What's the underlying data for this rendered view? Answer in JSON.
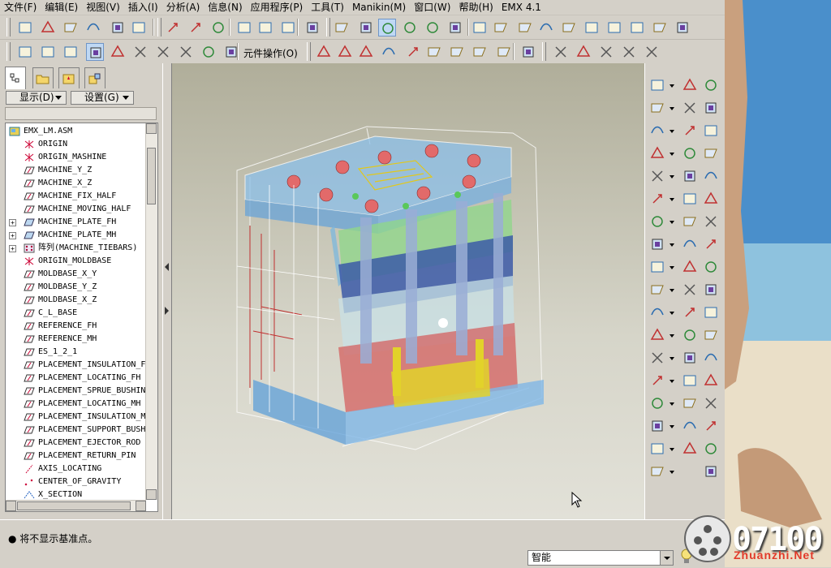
{
  "menu": {
    "items": [
      "文件(F)",
      "编辑(E)",
      "视图(V)",
      "插入(I)",
      "分析(A)",
      "信息(N)",
      "应用程序(P)",
      "工具(T)",
      "Manikin(M)",
      "窗口(W)",
      "帮助(H)",
      "EMX 4.1"
    ]
  },
  "toolbar2": {
    "component_op_label": "元件操作(O)"
  },
  "leftpanel": {
    "show_dropdown": "显示(D)",
    "settings_dropdown": "设置(G)",
    "tree": [
      {
        "label": "EMX_LM.ASM",
        "icon": "assembly-icon",
        "expand": ""
      },
      {
        "label": "ORIGIN",
        "icon": "csys-icon",
        "expand": ""
      },
      {
        "label": "ORIGIN_MASHINE",
        "icon": "csys-icon",
        "expand": ""
      },
      {
        "label": "MACHINE_Y_Z",
        "icon": "datum-plane-icon",
        "expand": ""
      },
      {
        "label": "MACHINE_X_Z",
        "icon": "datum-plane-icon",
        "expand": ""
      },
      {
        "label": "MACHINE_FIX_HALF",
        "icon": "datum-plane-icon",
        "expand": ""
      },
      {
        "label": "MACHINE_MOVING_HALF",
        "icon": "datum-plane-icon",
        "expand": ""
      },
      {
        "label": "MACHINE_PLATE_FH",
        "icon": "part-icon",
        "expand": "+"
      },
      {
        "label": "MACHINE_PLATE_MH",
        "icon": "part-icon",
        "expand": "+"
      },
      {
        "label": "阵列(MACHINE_TIEBARS)",
        "icon": "pattern-icon",
        "expand": "+"
      },
      {
        "label": "ORIGIN_MOLDBASE",
        "icon": "csys-icon",
        "expand": ""
      },
      {
        "label": "MOLDBASE_X_Y",
        "icon": "datum-plane-icon",
        "expand": ""
      },
      {
        "label": "MOLDBASE_Y_Z",
        "icon": "datum-plane-icon",
        "expand": ""
      },
      {
        "label": "MOLDBASE_X_Z",
        "icon": "datum-plane-icon",
        "expand": ""
      },
      {
        "label": "C_L_BASE",
        "icon": "datum-plane-icon",
        "expand": ""
      },
      {
        "label": "REFERENCE_FH",
        "icon": "datum-plane-icon",
        "expand": ""
      },
      {
        "label": "REFERENCE_MH",
        "icon": "datum-plane-icon",
        "expand": ""
      },
      {
        "label": "ES_1_2_1",
        "icon": "datum-plane-icon",
        "expand": ""
      },
      {
        "label": "PLACEMENT_INSULATION_F",
        "icon": "datum-plane-icon",
        "expand": ""
      },
      {
        "label": "PLACEMENT_LOCATING_FH",
        "icon": "datum-plane-icon",
        "expand": ""
      },
      {
        "label": "PLACEMENT_SPRUE_BUSHIN",
        "icon": "datum-plane-icon",
        "expand": ""
      },
      {
        "label": "PLACEMENT_LOCATING_MH",
        "icon": "datum-plane-icon",
        "expand": ""
      },
      {
        "label": "PLACEMENT_INSULATION_M",
        "icon": "datum-plane-icon",
        "expand": ""
      },
      {
        "label": "PLACEMENT_SUPPORT_BUSH",
        "icon": "datum-plane-icon",
        "expand": ""
      },
      {
        "label": "PLACEMENT_EJECTOR_ROD",
        "icon": "datum-plane-icon",
        "expand": ""
      },
      {
        "label": "PLACEMENT_RETURN_PIN",
        "icon": "datum-plane-icon",
        "expand": ""
      },
      {
        "label": "AXIS_LOCATING",
        "icon": "datum-axis-icon",
        "expand": ""
      },
      {
        "label": "CENTER_OF_GRAVITY",
        "icon": "datum-point-icon",
        "expand": ""
      },
      {
        "label": "X_SECTION",
        "icon": "section-icon",
        "expand": ""
      }
    ]
  },
  "status": {
    "message": "将不显示基准点。",
    "filter_value": "智能"
  },
  "overlay": {
    "counter": "07100",
    "watermark": "Zhuanzhi.Net"
  },
  "colors": {
    "plate_blue": "#7fb6e6",
    "plate_green": "#8fd68a",
    "plate_dark_blue": "#3c5aa8",
    "plate_red": "#d45b5b",
    "ejector_yellow": "#e2d22a"
  }
}
